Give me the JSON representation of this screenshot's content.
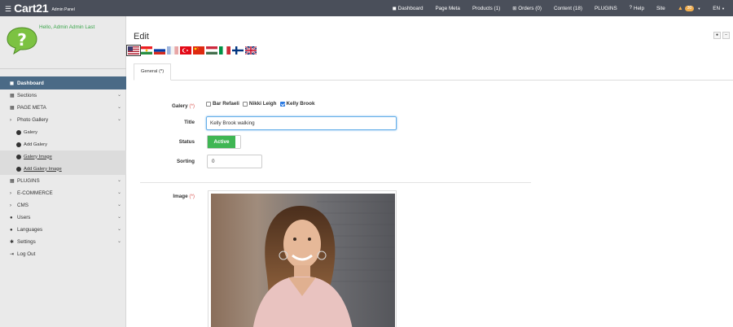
{
  "topbar": {
    "brand": "Cart21",
    "brand_sub": "Admin Panel",
    "nav": [
      {
        "icon": "dashboard-icon",
        "glyph": "◼",
        "label": "Dashboard"
      },
      {
        "icon": "",
        "glyph": "",
        "label": "Page Meta"
      },
      {
        "icon": "",
        "glyph": "",
        "label": "Products (1)"
      },
      {
        "icon": "cart-icon",
        "glyph": "⊞",
        "label": "Orders (0)"
      },
      {
        "icon": "",
        "glyph": "",
        "label": "Content (18)"
      },
      {
        "icon": "",
        "glyph": "",
        "label": "PLUGINS"
      },
      {
        "icon": "help-icon",
        "glyph": "?",
        "label": "Help"
      },
      {
        "icon": "",
        "glyph": "",
        "label": "Site"
      }
    ],
    "alerts_count": "30",
    "language": "EN"
  },
  "sidebar": {
    "greeting": "Hello, Admin Admin Last",
    "items": [
      {
        "label": "Dashboard",
        "glyph": "◼",
        "icon": "home-icon",
        "active": true,
        "sub": false,
        "chevron": false
      },
      {
        "label": "Sections",
        "glyph": "▦",
        "icon": "grid-icon",
        "active": false,
        "sub": false,
        "chevron": true
      },
      {
        "label": "PAGE META",
        "glyph": "▦",
        "icon": "grid-icon",
        "active": false,
        "sub": false,
        "chevron": true
      },
      {
        "label": "Photo Gallery",
        "glyph": "›",
        "icon": "chevron-right-icon",
        "active": false,
        "sub": false,
        "chevron": true
      },
      {
        "label": "Galery",
        "glyph": "",
        "icon": "dot-icon",
        "active": false,
        "sub": true,
        "chevron": false
      },
      {
        "label": "Add Galery",
        "glyph": "",
        "icon": "dot-icon",
        "active": false,
        "sub": true,
        "chevron": false
      },
      {
        "label": "Galery Image",
        "glyph": "",
        "icon": "dot-icon",
        "active": false,
        "sub": true,
        "chevron": false,
        "highlight": true,
        "underline": true
      },
      {
        "label": "Add Galery Image",
        "glyph": "",
        "icon": "dot-icon",
        "active": false,
        "sub": true,
        "chevron": false,
        "highlight": true,
        "underline": true
      },
      {
        "label": "PLUGINS",
        "glyph": "▦",
        "icon": "grid-icon",
        "active": false,
        "sub": false,
        "chevron": true
      },
      {
        "label": "E-COMMERCE",
        "glyph": "›",
        "icon": "chevron-right-icon",
        "active": false,
        "sub": false,
        "chevron": true
      },
      {
        "label": "CMS",
        "glyph": "›",
        "icon": "chevron-right-icon",
        "active": false,
        "sub": false,
        "chevron": true
      },
      {
        "label": "Users",
        "glyph": "●",
        "icon": "user-icon",
        "active": false,
        "sub": false,
        "chevron": true
      },
      {
        "label": "Languages",
        "glyph": "●",
        "icon": "user-icon",
        "active": false,
        "sub": false,
        "chevron": true
      },
      {
        "label": "Settings",
        "glyph": "✱",
        "icon": "gear-icon",
        "active": false,
        "sub": false,
        "chevron": true
      },
      {
        "label": "Log Out",
        "glyph": "⇥",
        "icon": "logout-icon",
        "active": false,
        "sub": false,
        "chevron": false
      }
    ]
  },
  "main": {
    "title": "Edit",
    "flags": [
      "us-flag-icon",
      "kurdish-flag-icon",
      "russian-flag-icon",
      "french-flag-icon",
      "turkish-flag-icon",
      "chinese-flag-icon",
      "hungarian-flag-icon",
      "italian-flag-icon",
      "finnish-flag-icon",
      "uk-flag-icon"
    ],
    "tab_label": "General",
    "tab_req": "(*)",
    "form": {
      "galery_label": "Galery",
      "required_mark": "(*)",
      "galery_options": [
        {
          "label": "Bar Refaeli",
          "checked": false
        },
        {
          "label": "Nikki Leigh",
          "checked": false
        },
        {
          "label": "Kelly Brook",
          "checked": true
        }
      ],
      "title_label": "Title",
      "title_value": "Kelly Brook walking",
      "status_label": "Status",
      "status_value": "Active",
      "sorting_label": "Sorting",
      "sorting_value": "0",
      "image_label": "Image"
    }
  },
  "colors": {
    "topbar": "#4a4f5a",
    "sidebar_active": "#4a6a86",
    "greeting": "#3aa54a",
    "toggle_on": "#3fb653",
    "badge": "#f0ad4e",
    "required": "#d9534f"
  }
}
